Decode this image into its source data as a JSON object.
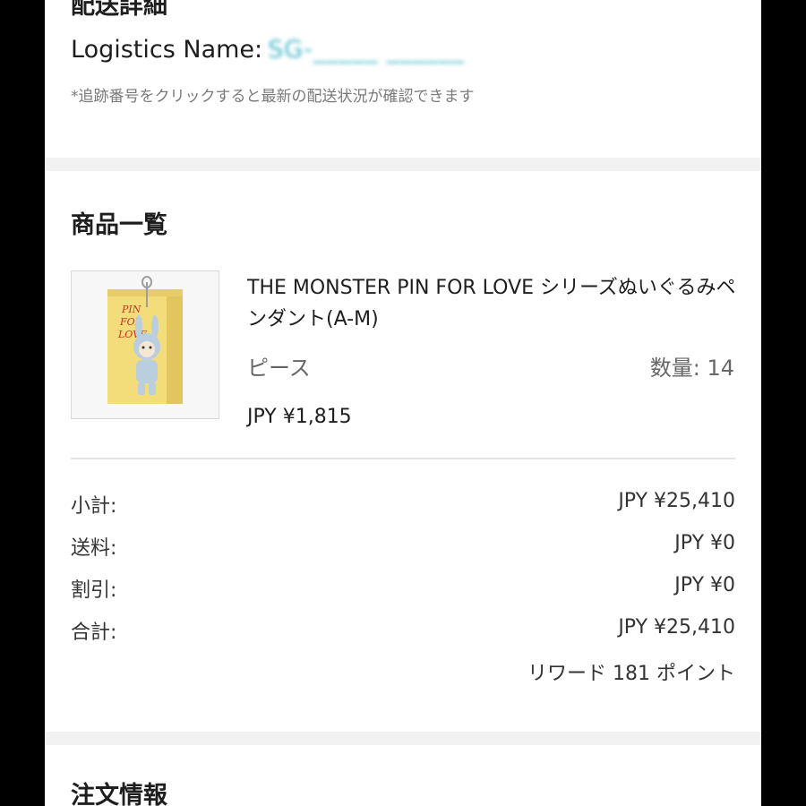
{
  "shipping": {
    "title": "配送詳細",
    "logistics_label": "Logistics Name:",
    "logistics_value": "SG-_____ ______",
    "hint": "*追跡番号をクリックすると最新の配送状況が確認できます"
  },
  "items": {
    "title": "商品一覧",
    "product": {
      "name": "THE MONSTER PIN FOR LOVE シリーズぬいぐるみペンダント(A-M)",
      "unit": "ピース",
      "quantity": "数量: 14",
      "price": "JPY ¥1,815",
      "image_text": [
        "PIN",
        "FOR",
        "LOVE"
      ]
    },
    "summary": [
      {
        "label": "小計:",
        "value": "JPY ¥25,410"
      },
      {
        "label": "送料:",
        "value": "JPY ¥0"
      },
      {
        "label": "割引:",
        "value": "JPY ¥0"
      },
      {
        "label": "合計:",
        "value": "JPY ¥25,410"
      }
    ],
    "rewards": "リワード 181 ポイント"
  },
  "order": {
    "title": "注文情報"
  },
  "colors": {
    "page_background": "#000000",
    "panel_background": "#ffffff",
    "section_gap": "#f2f2f2",
    "link_teal": "#3fb7c9",
    "package_yellow": "#f3dc7a"
  }
}
